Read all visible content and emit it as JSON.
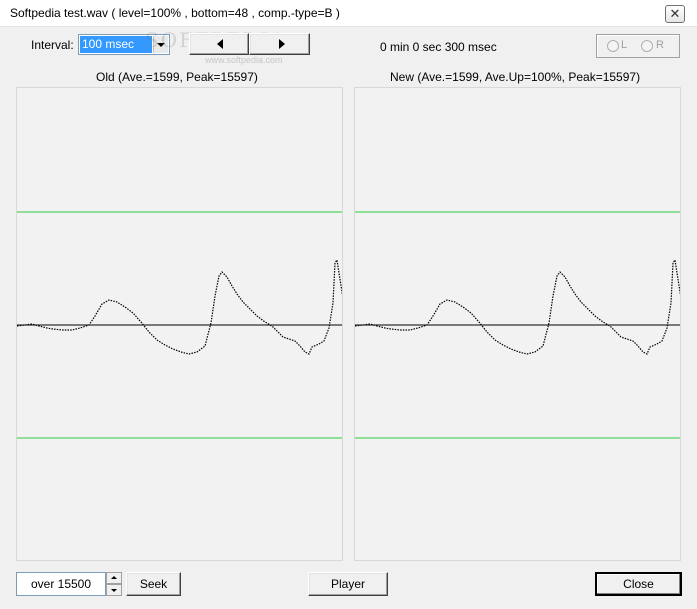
{
  "window": {
    "title": "Softpedia test.wav ( level=100% , bottom=48 , comp.-type=B )",
    "close_glyph": "✕"
  },
  "toolbar": {
    "interval_label": "Interval:",
    "interval_value": "100 msec",
    "time_display": "0 min 0 sec 300 msec",
    "channel_radios": [
      {
        "label": "L",
        "selected": false,
        "enabled": false
      },
      {
        "label": "R",
        "selected": false,
        "enabled": false
      }
    ],
    "watermark": "SOFTPEDIA",
    "watermark_url": "www.softpedia.com"
  },
  "panels": {
    "old_caption": "Old  (Ave.=1599, Peak=15597)",
    "new_caption": "New  (Ave.=1599, Ave.Up=100%, Peak=15597)"
  },
  "bottom": {
    "seek_value": "over 15500",
    "seek_label": "Seek",
    "player_label": "Player",
    "close_label": "Close"
  },
  "colors": {
    "threshold_line": "#2ecc40",
    "baseline": "#000000",
    "waveform": "#000000",
    "selection": "#3399ff"
  },
  "icons": {
    "prev": "triangle-left-icon",
    "next": "triangle-right-icon",
    "dropdown": "chevron-down-icon",
    "spin_up": "spin-up-icon",
    "spin_down": "spin-down-icon"
  }
}
